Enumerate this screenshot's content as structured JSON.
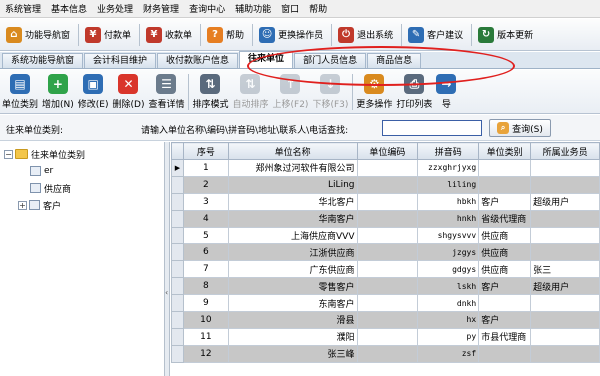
{
  "menu": [
    "系统管理",
    "基本信息",
    "业务处理",
    "财务管理",
    "查询中心",
    "辅助功能",
    "窗口",
    "帮助"
  ],
  "toolbar": [
    {
      "label": "功能导航窗",
      "icon": "house-icon",
      "color": "#d98a1f"
    },
    {
      "label": "付款单",
      "icon": "payment-icon",
      "color": "#c0392b"
    },
    {
      "label": "收款单",
      "icon": "receipt-icon",
      "color": "#c0392b"
    },
    {
      "label": "帮助",
      "icon": "help-icon",
      "color": "#e67e22"
    },
    {
      "label": "更换操作员",
      "icon": "users-icon",
      "color": "#2e6db4"
    },
    {
      "label": "退出系统",
      "icon": "exit-icon",
      "color": "#c0392b"
    },
    {
      "label": "客户建议",
      "icon": "edit-icon",
      "color": "#2e6db4"
    },
    {
      "label": "版本更新",
      "icon": "update-icon",
      "color": "#2a7a3a"
    }
  ],
  "tabs": [
    {
      "label": "系统功能导航窗",
      "active": false
    },
    {
      "label": "会计科目维护",
      "active": false
    },
    {
      "label": "收付款账户信息",
      "active": false
    },
    {
      "label": "往来单位",
      "active": true
    },
    {
      "label": "部门人员信息",
      "active": false
    },
    {
      "label": "商品信息",
      "active": false
    }
  ],
  "actions": [
    {
      "label": "单位类别",
      "icon": "category-icon",
      "color": "#2e6db4",
      "enabled": true
    },
    {
      "label": "增加(N)",
      "icon": "add-icon",
      "color": "#2fa34a",
      "enabled": true
    },
    {
      "label": "修改(E)",
      "icon": "modify-icon",
      "color": "#2e6db4",
      "enabled": true
    },
    {
      "label": "删除(D)",
      "icon": "delete-icon",
      "color": "#d9352b",
      "enabled": true
    },
    {
      "label": "查看详情",
      "icon": "details-icon",
      "color": "#6b7b8c",
      "enabled": true
    },
    {
      "label": "排序模式",
      "icon": "sort-icon",
      "color": "#5a6a7d",
      "enabled": true
    },
    {
      "label": "自动排序",
      "icon": "auto-sort-icon",
      "color": "#8a97a6",
      "enabled": false
    },
    {
      "label": "上移(F2)",
      "icon": "move-up-icon",
      "color": "#8a97a6",
      "enabled": false
    },
    {
      "label": "下移(F3)",
      "icon": "move-down-icon",
      "color": "#8a97a6",
      "enabled": false
    },
    {
      "label": "更多操作",
      "icon": "more-icon",
      "color": "#d98a1f",
      "enabled": true
    },
    {
      "label": "打印列表",
      "icon": "print-icon",
      "color": "#5a6a7d",
      "enabled": true
    },
    {
      "label": "导",
      "icon": "export-icon",
      "color": "#2e6db4",
      "enabled": true
    }
  ],
  "search": {
    "category_label": "往来单位类别:",
    "query_label": "请输入单位名称\\编码\\拼音码\\地址\\联系人\\电话查找:",
    "value": "",
    "button_label": "查询(S)"
  },
  "tree": {
    "root": "往来单位类别",
    "children": [
      "er",
      "供应商",
      "客户"
    ]
  },
  "table": {
    "columns": [
      "序号",
      "单位名称",
      "单位编码",
      "拼音码",
      "单位类别",
      "所属业务员"
    ],
    "rows": [
      [
        "1",
        "郑州象过河软件有限公司",
        "",
        "zzxghrjyxg",
        "",
        ""
      ],
      [
        "2",
        "LiLing",
        "",
        "liling",
        "",
        ""
      ],
      [
        "3",
        "华北客户",
        "",
        "hbkh",
        "客户",
        "超级用户"
      ],
      [
        "4",
        "华南客户",
        "",
        "hnkh",
        "省级代理商",
        ""
      ],
      [
        "5",
        "上海供应商VVV",
        "",
        "shgysvvv",
        "供应商",
        ""
      ],
      [
        "6",
        "江浙供应商",
        "",
        "jzgys",
        "供应商",
        ""
      ],
      [
        "7",
        "广东供应商",
        "",
        "gdgys",
        "供应商",
        "张三"
      ],
      [
        "8",
        "零售客户",
        "",
        "lskh",
        "客户",
        "超级用户"
      ],
      [
        "9",
        "东南客户",
        "",
        "dnkh",
        "",
        ""
      ],
      [
        "10",
        "滑县",
        "",
        "hx",
        "客户",
        ""
      ],
      [
        "11",
        "濮阳",
        "",
        "py",
        "市县代理商",
        ""
      ],
      [
        "12",
        "张三峰",
        "",
        "zsf",
        "",
        ""
      ]
    ]
  },
  "colors": {
    "annotation": "#e0201e",
    "alt_row": "#c7c7c7"
  }
}
